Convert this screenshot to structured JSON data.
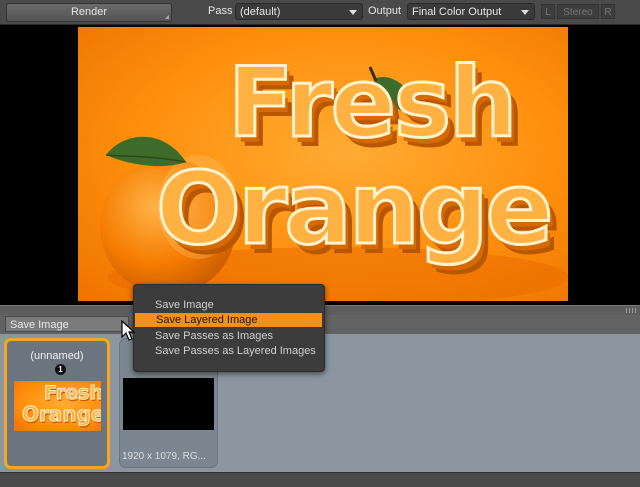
{
  "toolbar": {
    "render_label": "Render",
    "pass_label": "Pass",
    "pass_value": "(default)",
    "output_label": "Output",
    "output_value": "Final Color Output",
    "left_eye": "L",
    "stereo": "Stereo",
    "right_eye": "R"
  },
  "artwork": {
    "word1": "Fresh",
    "word2": "Orange"
  },
  "save_combo": {
    "value": "Save Image"
  },
  "context_menu": {
    "items": [
      {
        "label": "Save Image",
        "highlighted": false
      },
      {
        "label": "Save Layered Image",
        "highlighted": true
      },
      {
        "label": "Save Passes as Images",
        "highlighted": false
      },
      {
        "label": "Save Passes as Layered Images",
        "highlighted": false
      }
    ]
  },
  "thumbnails": [
    {
      "name": "(unnamed)",
      "badge": "1",
      "mini_word1": "Fresh",
      "mini_word2": "Orange",
      "selected": true
    },
    {
      "info": "1920 x 1079, RG..."
    }
  ],
  "colors": {
    "accent": "#f39018",
    "selected_border": "#f5a623",
    "artwork_bg": "#ff8f0c"
  }
}
